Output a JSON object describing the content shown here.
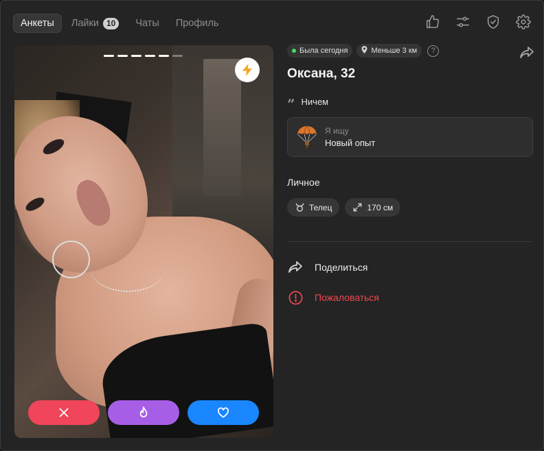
{
  "nav": {
    "tabs": [
      {
        "label": "Анкеты",
        "active": true
      },
      {
        "label": "Лайки",
        "badge": "10"
      },
      {
        "label": "Чаты"
      },
      {
        "label": "Профиль"
      }
    ],
    "icons": [
      "thumbs-up-icon",
      "sliders-icon",
      "shield-check-icon",
      "gear-icon"
    ]
  },
  "photo": {
    "total_photos": 6,
    "current_photo": 5
  },
  "profile": {
    "status": "Была сегодня",
    "status_color": "#4cd964",
    "distance": "Меньше 3 км",
    "help": "?",
    "name": "Оксана, 32",
    "quote": "Ничем",
    "seeking_label": "Я ищу",
    "seeking_value": "Новый опыт",
    "personal_title": "Личное",
    "zodiac": "Телец",
    "height": "170 см"
  },
  "menu": {
    "share": "Поделиться",
    "report": "Пожаловаться",
    "report_color": "#f0474f"
  },
  "colors": {
    "nope": "#f0455a",
    "super": "#a65ee6",
    "like": "#1a86ff",
    "boost": "#f5a623"
  }
}
